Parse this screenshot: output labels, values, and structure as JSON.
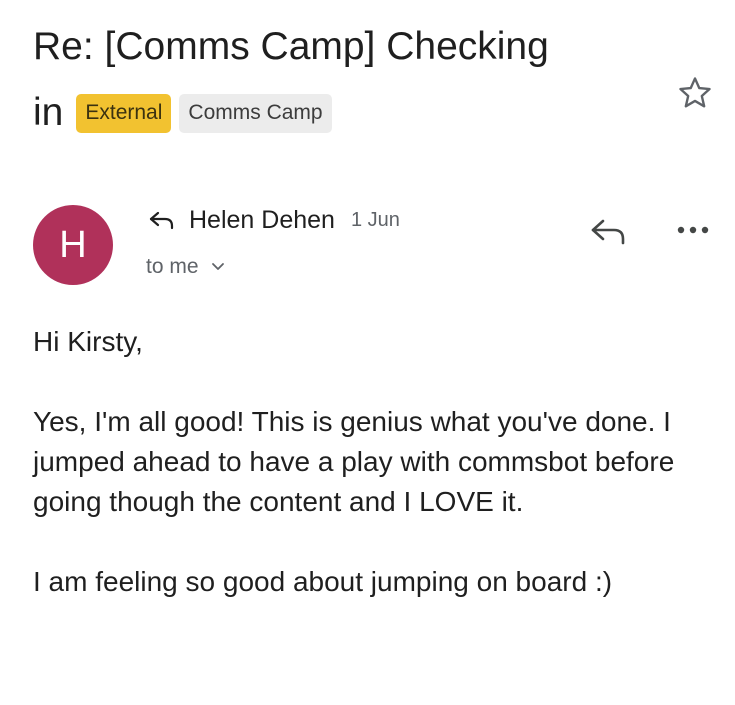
{
  "email": {
    "subject_line1": "Re: [Comms Camp] Checking",
    "subject_line2": "in",
    "labels": [
      {
        "text": "External",
        "color": "#f2c230"
      },
      {
        "text": "Comms Camp",
        "color": "#ececec"
      }
    ],
    "star_icon": "star-outline-icon",
    "sender": {
      "avatar_letter": "H",
      "avatar_color": "#b0315a",
      "reply_indicator_icon": "reply-arrow-icon",
      "name": "Helen Dehen",
      "date": "1 Jun",
      "recipient_text": "to me",
      "recipient_toggle_icon": "chevron-down-icon"
    },
    "actions": {
      "reply_icon": "reply-icon",
      "more_icon": "more-horizontal-icon"
    },
    "body": {
      "greeting": "Hi Kirsty,",
      "paragraph1": "Yes, I'm all good! This is genius what you've done. I jumped ahead to have a play with commsbot before going though the content and I LOVE it.",
      "paragraph2": "I am feeling so good about jumping on board :)"
    }
  }
}
